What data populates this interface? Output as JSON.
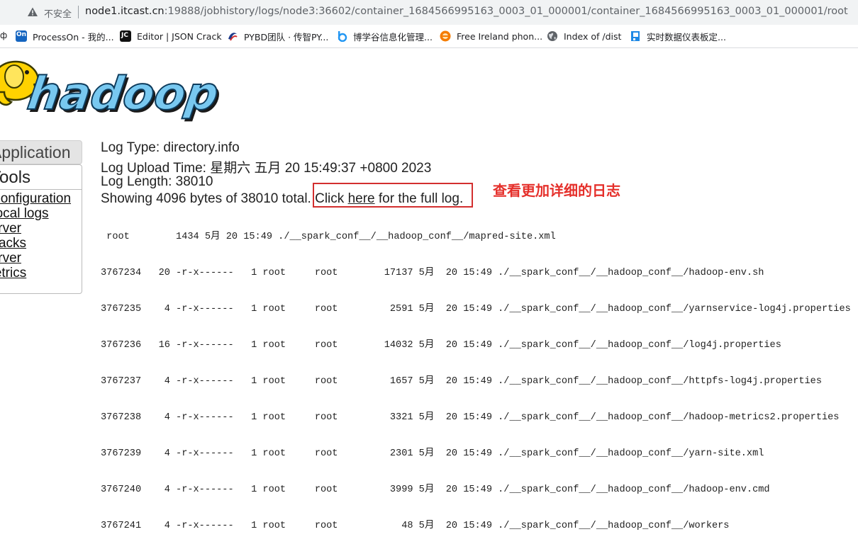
{
  "browser": {
    "insecure_label": "不安全",
    "url_host": "node1.itcast.cn",
    "url_path": ":19888/jobhistory/logs/node3:36602/container_1684566995163_0003_01_000001/container_1684566995163_0003_01_000001/root"
  },
  "bookmarks": {
    "lead": "ф",
    "items": [
      {
        "label": "ProcessOn - 我的...",
        "icon": "processon-icon",
        "color": "#1565c0"
      },
      {
        "label": "Editor | JSON Crack",
        "icon": "jsoncrack-icon",
        "color": "#111111"
      },
      {
        "label": "PYBD团队 · 传智PY...",
        "icon": "pybd-icon",
        "color": "#1e3a8a"
      },
      {
        "label": "博学谷信息化管理...",
        "icon": "boxuegu-icon",
        "color": "#2196f3"
      },
      {
        "label": "Free Ireland phon...",
        "icon": "ireland-icon",
        "color": "#f57c00"
      },
      {
        "label": "Index of /dist",
        "icon": "globe-icon",
        "color": "#5f6368"
      },
      {
        "label": "实时数据仪表板定...",
        "icon": "dashboard-icon",
        "color": "#1e88e5"
      }
    ]
  },
  "logo": {
    "text": "hadoop"
  },
  "nav": {
    "application": "Application",
    "tools": "Tools",
    "links": [
      "Configuration",
      "Local logs",
      "Server",
      "Stacks",
      "Server",
      "Metrics"
    ]
  },
  "log_info": {
    "type": "Log Type: directory.info",
    "upload_time": "Log Upload Time: 星期六 五月 20 15:49:37 +0800 2023",
    "length": "Log Length: 38010",
    "showing_prefix": "Showing 4096 bytes of 38010 total. Click ",
    "here": "here",
    "showing_suffix": " for the full log."
  },
  "annotation": "查看更加详细的日志",
  "log_lines": [
    " root        1434 5月 20 15:49 ./__spark_conf__/__hadoop_conf__/mapred-site.xml",
    "3767234   20 -r-x------   1 root     root        17137 5月  20 15:49 ./__spark_conf__/__hadoop_conf__/hadoop-env.sh",
    "3767235    4 -r-x------   1 root     root         2591 5月  20 15:49 ./__spark_conf__/__hadoop_conf__/yarnservice-log4j.properties",
    "3767236   16 -r-x------   1 root     root        14032 5月  20 15:49 ./__spark_conf__/__hadoop_conf__/log4j.properties",
    "3767237    4 -r-x------   1 root     root         1657 5月  20 15:49 ./__spark_conf__/__hadoop_conf__/httpfs-log4j.properties",
    "3767238    4 -r-x------   1 root     root         3321 5月  20 15:49 ./__spark_conf__/__hadoop_conf__/hadoop-metrics2.properties",
    "3767239    4 -r-x------   1 root     root         2301 5月  20 15:49 ./__spark_conf__/__hadoop_conf__/yarn-site.xml",
    "3767240    4 -r-x------   1 root     root         3999 5月  20 15:49 ./__spark_conf__/__hadoop_conf__/hadoop-env.cmd",
    "3767241    4 -r-x------   1 root     root           48 5月  20 15:49 ./__spark_conf__/__hadoop_conf__/workers"
  ]
}
